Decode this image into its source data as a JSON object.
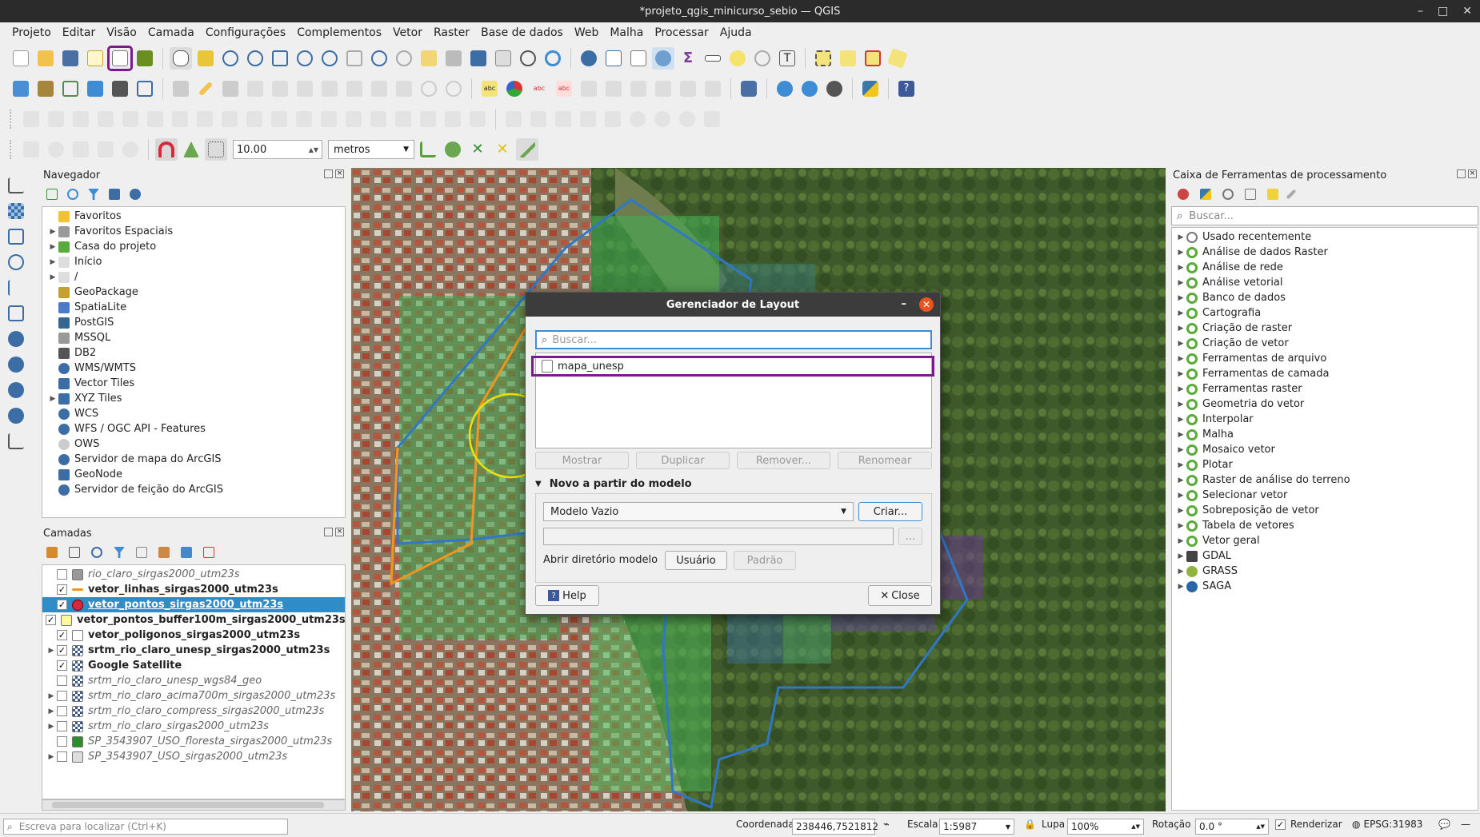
{
  "window": {
    "title": "*projeto_qgis_minicurso_sebio — QGIS"
  },
  "menu": [
    "Projeto",
    "Editar",
    "Visão",
    "Camada",
    "Configurações",
    "Complementos",
    "Vetor",
    "Raster",
    "Base de dados",
    "Web",
    "Malha",
    "Processar",
    "Ajuda"
  ],
  "snapping": {
    "tolerance": "10.00",
    "units": "metros"
  },
  "navigator": {
    "title": "Navegador",
    "items": [
      {
        "label": "Favoritos",
        "icon": "star-icon",
        "expand": false
      },
      {
        "label": "Favoritos Espaciais",
        "icon": "spatial-bookmark-icon",
        "expand": true
      },
      {
        "label": "Casa do projeto",
        "icon": "project-home-icon",
        "expand": true
      },
      {
        "label": "Início",
        "icon": "home-folder-icon",
        "expand": true
      },
      {
        "label": "/",
        "icon": "folder-icon",
        "expand": true
      },
      {
        "label": "GeoPackage",
        "icon": "geopackage-icon",
        "expand": false
      },
      {
        "label": "SpatiaLite",
        "icon": "spatialite-icon",
        "expand": false
      },
      {
        "label": "PostGIS",
        "icon": "postgis-icon",
        "expand": false
      },
      {
        "label": "MSSQL",
        "icon": "mssql-icon",
        "expand": false
      },
      {
        "label": "DB2",
        "icon": "db2-icon",
        "expand": false
      },
      {
        "label": "WMS/WMTS",
        "icon": "wms-icon",
        "expand": false
      },
      {
        "label": "Vector Tiles",
        "icon": "vector-tiles-icon",
        "expand": false
      },
      {
        "label": "XYZ Tiles",
        "icon": "xyz-tiles-icon",
        "expand": true
      },
      {
        "label": "WCS",
        "icon": "wcs-icon",
        "expand": false
      },
      {
        "label": "WFS / OGC API - Features",
        "icon": "wfs-icon",
        "expand": false
      },
      {
        "label": "OWS",
        "icon": "ows-icon",
        "expand": false
      },
      {
        "label": "Servidor de mapa do ArcGIS",
        "icon": "arcgis-map-icon",
        "expand": false
      },
      {
        "label": "GeoNode",
        "icon": "geonode-icon",
        "expand": false
      },
      {
        "label": "Servidor de feição do ArcGIS",
        "icon": "arcgis-feature-icon",
        "expand": false
      }
    ]
  },
  "layers": {
    "title": "Camadas",
    "items": [
      {
        "label": "rio_claro_sirgas2000_utm23s",
        "checked": false,
        "style": "i",
        "swatch": "#999999",
        "expand": false
      },
      {
        "label": "vetor_linhas_sirgas2000_utm23s",
        "checked": true,
        "style": "b",
        "swatch": "#f0961e",
        "expand": false
      },
      {
        "label": "vetor_pontos_sirgas2000_utm23s",
        "checked": true,
        "style": "b",
        "swatch": "#d8283c",
        "expand": false,
        "selected": true
      },
      {
        "label": "vetor_pontos_buffer100m_sirgas2000_utm23s",
        "checked": true,
        "style": "b",
        "swatch": "#fff6a0",
        "expand": false
      },
      {
        "label": "vetor_poligonos_sirgas2000_utm23s",
        "checked": true,
        "style": "b",
        "swatch": "#ffffff",
        "expand": false
      },
      {
        "label": "srtm_rio_claro_unesp_sirgas2000_utm23s",
        "checked": true,
        "style": "b",
        "swatch": "raster",
        "expand": true
      },
      {
        "label": "Google Satellite",
        "checked": true,
        "style": "b",
        "swatch": "raster",
        "expand": false
      },
      {
        "label": "srtm_rio_claro_unesp_wgs84_geo",
        "checked": false,
        "style": "i",
        "swatch": "raster",
        "expand": false
      },
      {
        "label": "srtm_rio_claro_acima700m_sirgas2000_utm23s",
        "checked": false,
        "style": "i",
        "swatch": "raster",
        "expand": true
      },
      {
        "label": "srtm_rio_claro_compress_sirgas2000_utm23s",
        "checked": false,
        "style": "i",
        "swatch": "raster",
        "expand": true
      },
      {
        "label": "srtm_rio_claro_sirgas2000_utm23s",
        "checked": false,
        "style": "i",
        "swatch": "raster",
        "expand": true
      },
      {
        "label": "SP_3543907_USO_floresta_sirgas2000_utm23s",
        "checked": false,
        "style": "i",
        "swatch": "#2d8c2d",
        "expand": false
      },
      {
        "label": "SP_3543907_USO_sirgas2000_utm23s",
        "checked": false,
        "style": "i",
        "swatch": "#dddddd",
        "expand": true
      }
    ]
  },
  "processing": {
    "title": "Caixa de Ferramentas de processamento",
    "search_placeholder": "Buscar...",
    "items": [
      {
        "label": "Usado recentemente",
        "icon": "clock-icon"
      },
      {
        "label": "Análise de dados Raster",
        "icon": "qgis-icon"
      },
      {
        "label": "Análise de rede",
        "icon": "qgis-icon"
      },
      {
        "label": "Análise vetorial",
        "icon": "qgis-icon"
      },
      {
        "label": "Banco de dados",
        "icon": "qgis-icon"
      },
      {
        "label": "Cartografia",
        "icon": "qgis-icon"
      },
      {
        "label": "Criação de raster",
        "icon": "qgis-icon"
      },
      {
        "label": "Criação de vetor",
        "icon": "qgis-icon"
      },
      {
        "label": "Ferramentas de arquivo",
        "icon": "qgis-icon"
      },
      {
        "label": "Ferramentas de camada",
        "icon": "qgis-icon"
      },
      {
        "label": "Ferramentas raster",
        "icon": "qgis-icon"
      },
      {
        "label": "Geometria do vetor",
        "icon": "qgis-icon"
      },
      {
        "label": "Interpolar",
        "icon": "qgis-icon"
      },
      {
        "label": "Malha",
        "icon": "qgis-icon"
      },
      {
        "label": "Mosaico vetor",
        "icon": "qgis-icon"
      },
      {
        "label": "Plotar",
        "icon": "qgis-icon"
      },
      {
        "label": "Raster de análise do terreno",
        "icon": "qgis-icon"
      },
      {
        "label": "Selecionar vetor",
        "icon": "qgis-icon"
      },
      {
        "label": "Sobreposição de vetor",
        "icon": "qgis-icon"
      },
      {
        "label": "Tabela de vetores",
        "icon": "qgis-icon"
      },
      {
        "label": "Vetor geral",
        "icon": "qgis-icon"
      },
      {
        "label": "GDAL",
        "icon": "gdal-icon"
      },
      {
        "label": "GRASS",
        "icon": "grass-icon"
      },
      {
        "label": "SAGA",
        "icon": "saga-icon"
      }
    ]
  },
  "dialog": {
    "title": "Gerenciador de Layout",
    "search_placeholder": "Buscar...",
    "layouts": [
      "mapa_unesp"
    ],
    "buttons": {
      "show": "Mostrar",
      "duplicate": "Duplicar",
      "remove": "Remover...",
      "rename": "Renomear"
    },
    "template_section": "Novo a partir do modelo",
    "template_select": "Modelo Vazio",
    "create": "Criar...",
    "browse": "...",
    "open_dir_label": "Abrir diretório modelo",
    "user": "Usuário",
    "default": "Padrão",
    "help": "Help",
    "close": "Close"
  },
  "status": {
    "locator_placeholder": "Escreva para localizar (Ctrl+K)",
    "coord_label": "Coordenada",
    "coord": "238446,7521812",
    "scale_label": "Escala",
    "scale": "1:5987",
    "magnifier_label": "Lupa",
    "magnifier": "100%",
    "rotation_label": "Rotação",
    "rotation": "0.0 °",
    "render_label": "Renderizar",
    "crs": "EPSG:31983"
  }
}
